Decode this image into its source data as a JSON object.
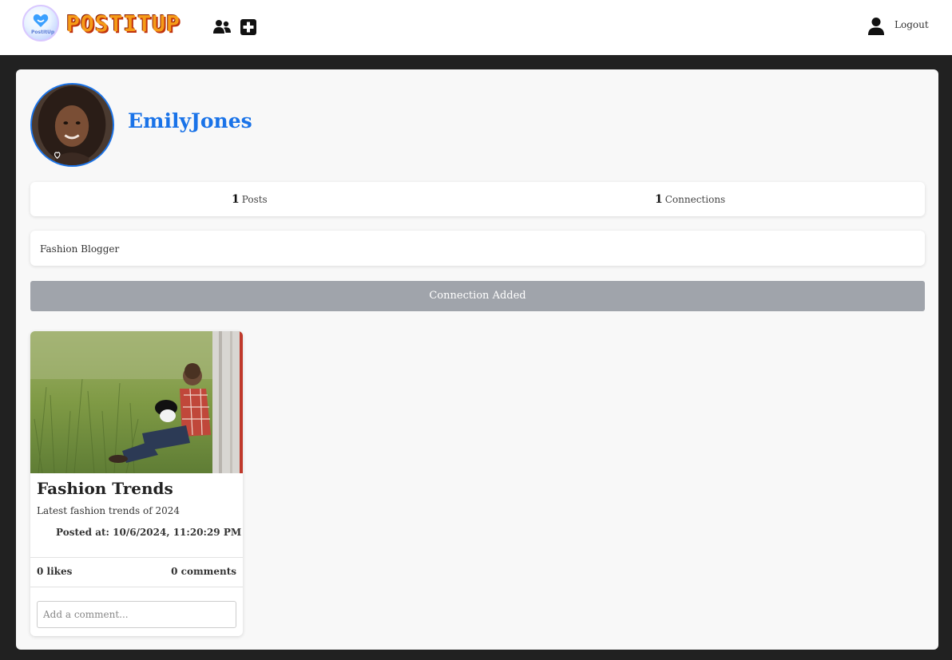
{
  "header": {
    "brand": "POSTITUP",
    "logo_small_text": "PostItUp",
    "logout_label": "Logout",
    "icons": [
      "users-icon",
      "plus-square-icon",
      "user-icon"
    ]
  },
  "profile": {
    "username": "EmilyJones",
    "posts_count": "1",
    "posts_label": "Posts",
    "connections_count": "1",
    "connections_label": "Connections",
    "bio": "Fashion Blogger",
    "connection_button": "Connection Added"
  },
  "posts": [
    {
      "title": "Fashion Trends",
      "description": "Latest fashion trends of 2024",
      "posted_at": "Posted at: 10/6/2024, 11:20:29 PM",
      "likes": "0 likes",
      "comments": "0 comments",
      "comment_placeholder": "Add a comment..."
    }
  ],
  "colors": {
    "accent": "#1a73e8",
    "page_bg": "#212121",
    "card_bg": "#f8f8f8",
    "button_disabled": "#a0a4ab",
    "brand_orange": "#f59b18"
  }
}
